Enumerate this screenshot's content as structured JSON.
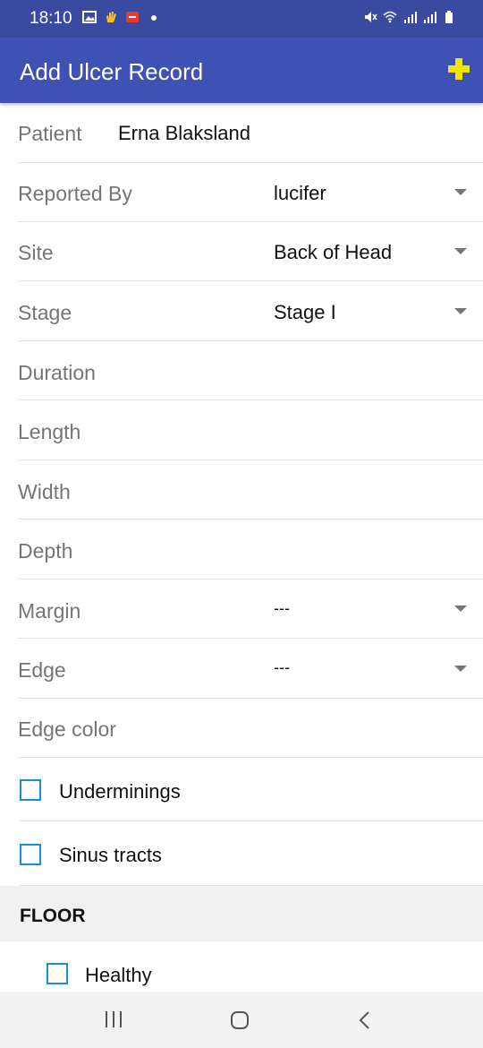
{
  "status_bar": {
    "time": "18:10",
    "left_icons": [
      "image-icon",
      "hand-wave-icon",
      "app-notification-icon",
      "dot-icon"
    ],
    "right_icons": [
      "mute-icon",
      "wifi-icon",
      "signal-icon",
      "signal-icon-2",
      "battery-icon"
    ]
  },
  "app_bar": {
    "title": "Add Ulcer Record",
    "action_icon": "plus-icon",
    "background": "#3f51b5",
    "action_color": "#f2e600"
  },
  "form": {
    "patient": {
      "label": "Patient",
      "value": "Erna Blaksland"
    },
    "reported_by": {
      "label": "Reported By",
      "value": "lucifer"
    },
    "site": {
      "label": "Site",
      "value": "Back of Head"
    },
    "stage": {
      "label": "Stage",
      "value": "Stage I"
    },
    "duration": {
      "label": "Duration"
    },
    "length": {
      "label": "Length"
    },
    "width": {
      "label": "Width"
    },
    "depth": {
      "label": "Depth"
    },
    "margin": {
      "label": "Margin",
      "value": "---"
    },
    "edge": {
      "label": "Edge",
      "value": "---"
    },
    "edge_color": {
      "label": "Edge color"
    },
    "underminings": {
      "label": "Underminings"
    },
    "sinus_tracts": {
      "label": "Sinus tracts"
    }
  },
  "floor": {
    "title": "FLOOR",
    "healthy": {
      "label": "Healthy"
    }
  },
  "nav_bar": {
    "icons": [
      "recent-apps-icon",
      "home-icon",
      "back-icon"
    ]
  }
}
